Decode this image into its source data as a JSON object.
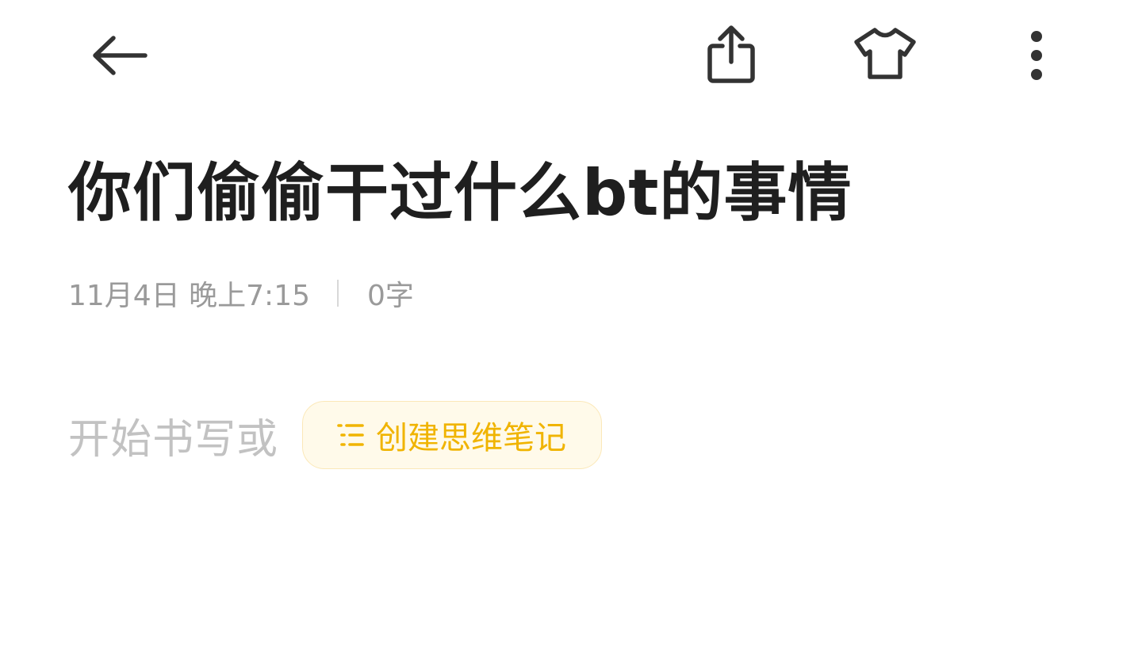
{
  "toolbar": {
    "back_icon": "arrow-left-icon",
    "share_icon": "share-icon",
    "theme_icon": "tshirt-icon",
    "more_icon": "more-vertical-icon",
    "icon_color": "#333333"
  },
  "note": {
    "title": "你们偷偷干过什么bt的事情",
    "date": "11月4日 晚上7:15",
    "word_count": "0字",
    "placeholder": "开始书写或",
    "mindmap_button_label": "创建思维笔记",
    "mindmap_button_icon": "list-icon",
    "accent_color": "#f0b400"
  }
}
